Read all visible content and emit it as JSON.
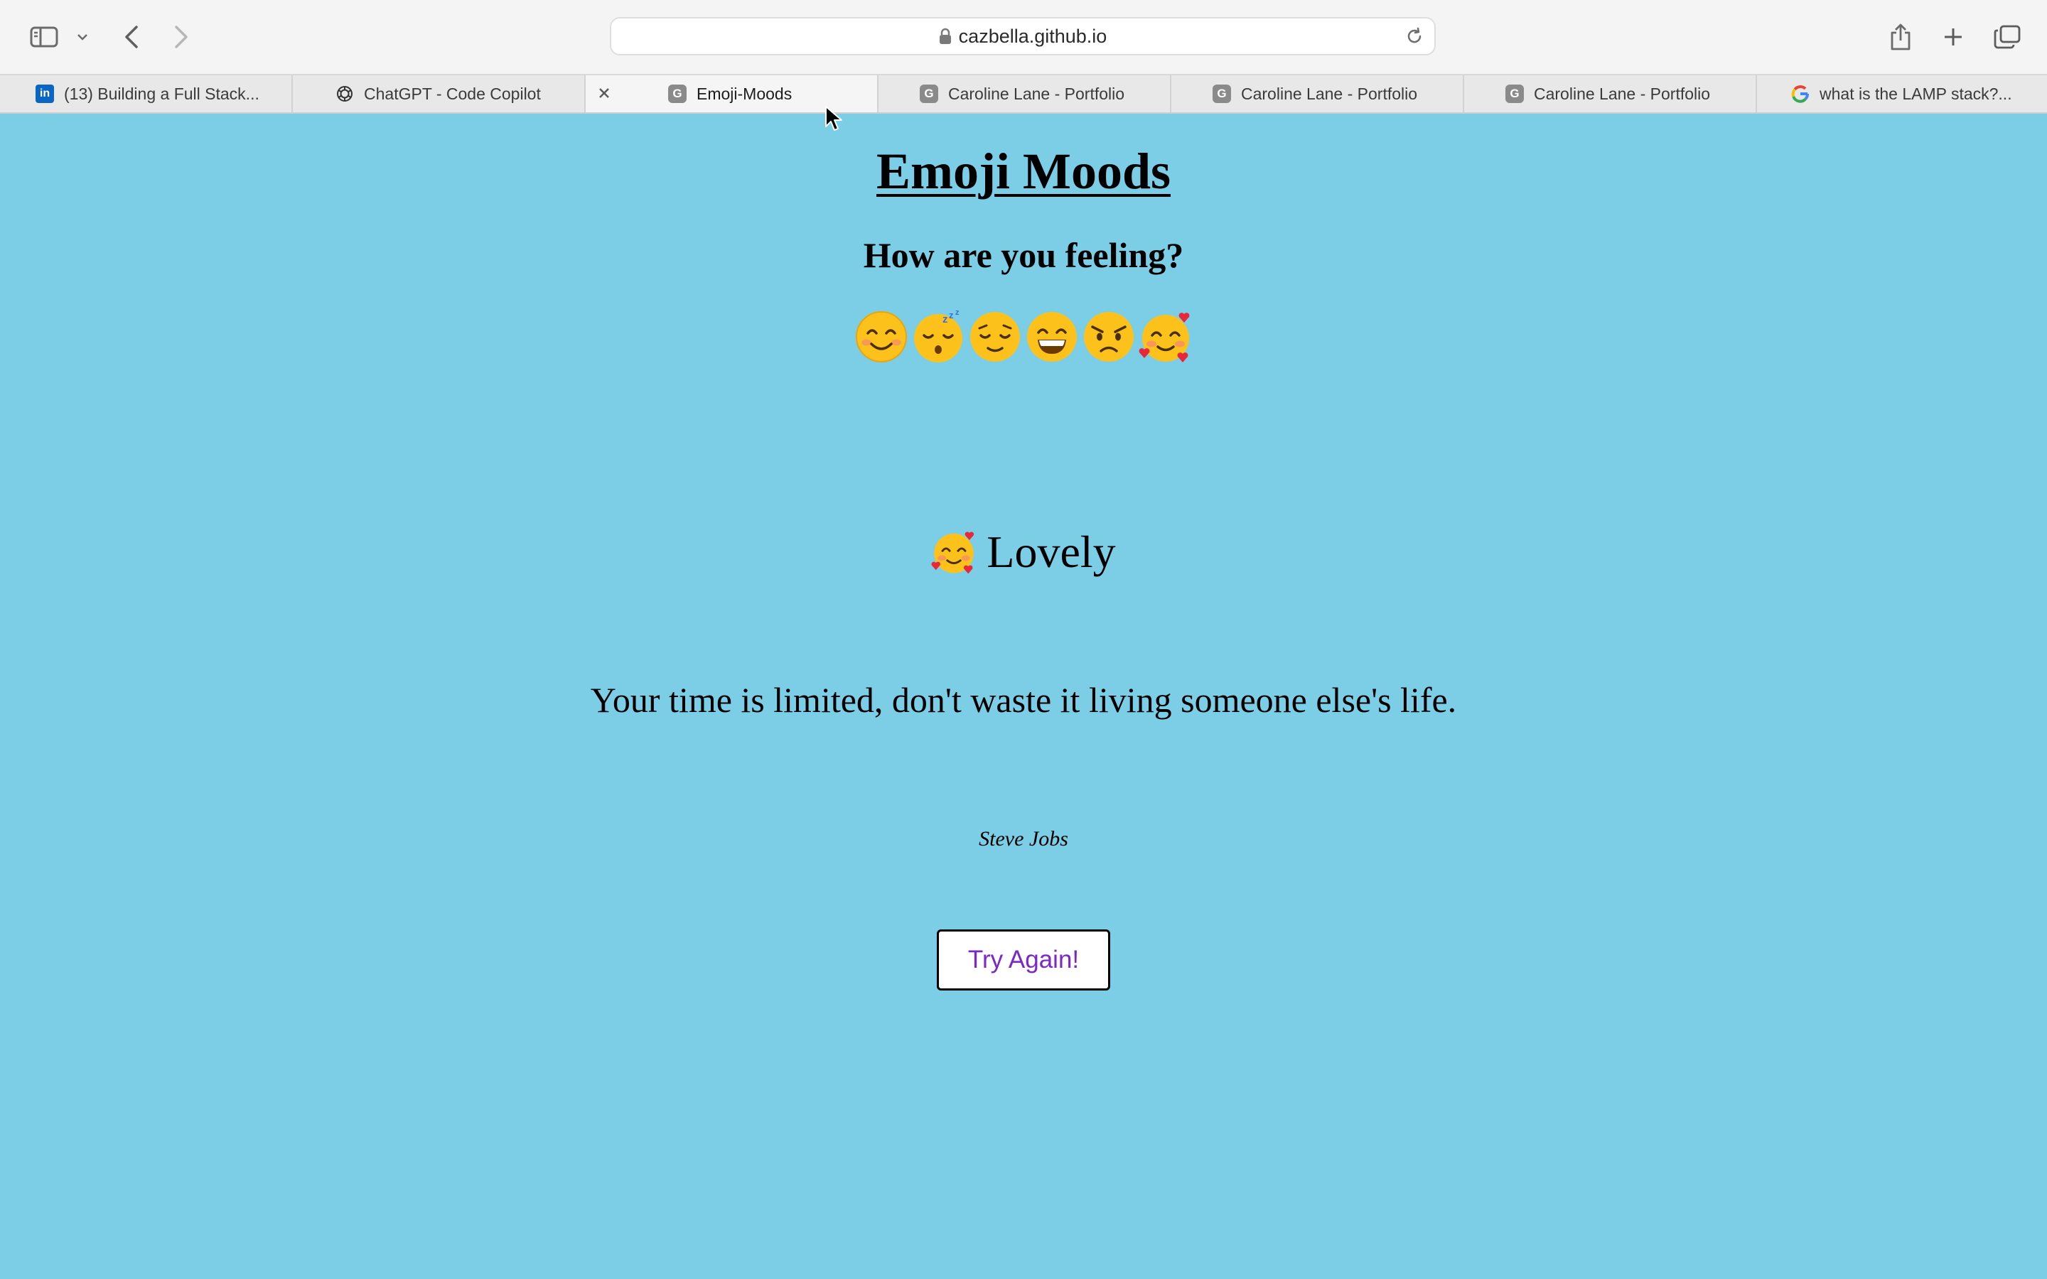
{
  "browser": {
    "url": "cazbella.github.io",
    "tabs": [
      {
        "label": "(13) Building a Full Stack...",
        "icon": "linkedin-icon",
        "active": false
      },
      {
        "label": "ChatGPT - Code Copilot",
        "icon": "chatgpt-icon",
        "active": false
      },
      {
        "label": "Emoji-Moods",
        "icon": "github-icon",
        "active": true
      },
      {
        "label": "Caroline Lane - Portfolio",
        "icon": "github-icon",
        "active": false
      },
      {
        "label": "Caroline Lane - Portfolio",
        "icon": "github-icon",
        "active": false
      },
      {
        "label": "Caroline Lane - Portfolio",
        "icon": "github-icon",
        "active": false
      },
      {
        "label": "what is the LAMP stack?...",
        "icon": "google-icon",
        "active": false
      }
    ]
  },
  "page": {
    "title": "Emoji Moods",
    "subtitle": "How are you feeling?",
    "emojis": [
      "smiling-face-icon",
      "sleeping-face-icon",
      "relieved-face-icon",
      "grinning-face-icon",
      "angry-face-icon",
      "smiling-face-with-hearts-icon"
    ],
    "result": {
      "emoji": "smiling-face-with-hearts-icon",
      "label": "Lovely"
    },
    "quote": "Your time is limited, don't waste it living someone else's life.",
    "author": "Steve Jobs",
    "try_again_label": "Try Again!"
  },
  "colors": {
    "page_background": "#7ccee6",
    "button_text": "#7b27c9"
  }
}
